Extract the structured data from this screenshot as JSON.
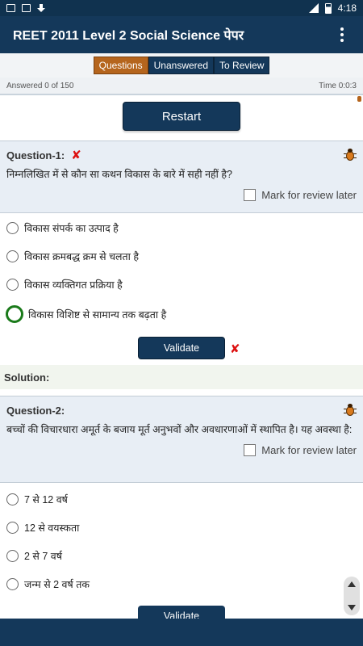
{
  "status_bar": {
    "time": "4:18"
  },
  "app_bar": {
    "title": "REET 2011 Level 2 Social Science पेपर"
  },
  "tabs": [
    {
      "label": "Questions",
      "active": true
    },
    {
      "label": "Unanswered",
      "active": false
    },
    {
      "label": "To Review",
      "active": false
    }
  ],
  "progress": {
    "answered": "Answered 0 of 150",
    "time": "Time 0:0:3"
  },
  "restart_label": "Restart",
  "questions": [
    {
      "label": "Question-1:",
      "text": "निम्नलिखित में से कौन सा कथन विकास के बारे में सही नहीं है?",
      "review_label": "Mark for review later",
      "options": [
        "विकास संपर्क का उत्पाद है",
        "विकास क्रमबद्ध क्रम से चलता है",
        "विकास व्यक्तिगत प्रक्रिया है",
        "विकास विशिष्ट से सामान्य तक बढ़ता है"
      ],
      "selected_option": 3,
      "validate_label": "Validate",
      "solution_label": "Solution:"
    },
    {
      "label": "Question-2:",
      "text": "बच्चों की विचारधारा अमूर्त के बजाय मूर्त अनुभवों और अवधारणाओं में स्थापित है। यह अवस्था है:",
      "review_label": "Mark for review later",
      "options": [
        "7 से 12 वर्ष",
        "12 से वयस्कता",
        "2 से 7 वर्ष",
        "जन्म से 2 वर्ष तक"
      ],
      "validate_label": "Validate"
    }
  ],
  "colors": {
    "primary": "#14385a",
    "accent": "#b5651d",
    "wrong": "#dd1111",
    "selected": "#1a7a1a"
  }
}
